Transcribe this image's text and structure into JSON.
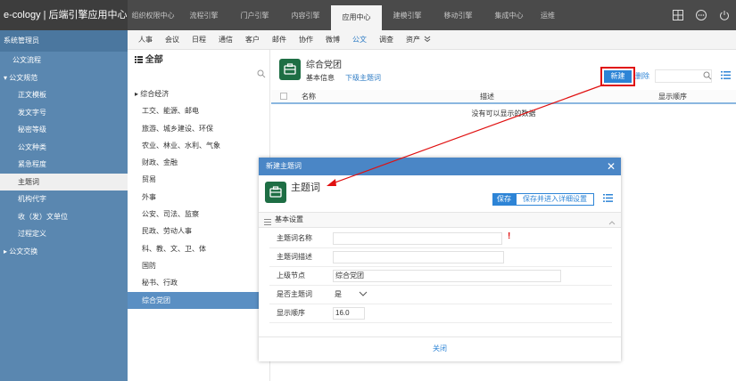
{
  "brand": "e-cology | 后端引擎应用中心",
  "top_nav": [
    "组织权限中心",
    "流程引擎",
    "门户引擎",
    "内容引擎",
    "应用中心",
    "建模引擎",
    "移动引擎",
    "集成中心",
    "运维"
  ],
  "sidebar": {
    "title": "系统管理员",
    "items": [
      "公文流程",
      "公文规范",
      "正文模板",
      "发文字号",
      "秘密等级",
      "公文种类",
      "紧急程度",
      "主题词",
      "机构代字",
      "收（发）文单位",
      "过程定义",
      "公文交换"
    ]
  },
  "subnav": [
    "人事",
    "会议",
    "日程",
    "通信",
    "客户",
    "邮件",
    "协作",
    "微博",
    "公文",
    "调查",
    "资产"
  ],
  "tree": {
    "head": "全部",
    "items": [
      "综合经济",
      "工交、能源、邮电",
      "旅游、城乡建设、环保",
      "农业、林业、水利、气象",
      "财政、金融",
      "贸易",
      "外事",
      "公安、司法、监察",
      "民政、劳动人事",
      "科、教、文、卫、体",
      "国防",
      "秘书、行政",
      "综合党团"
    ]
  },
  "main": {
    "title": "综合党团",
    "tab_basic": "基本信息",
    "tab_sub": "下级主题词",
    "new_label": "新建",
    "del_label": "删除",
    "columns": [
      "名称",
      "描述",
      "显示顺序"
    ],
    "empty": "没有可以显示的数据"
  },
  "modal": {
    "header": "新建主题词",
    "title": "主题词",
    "save": "保存",
    "save_next": "保存并进入详细设置",
    "section": "基本设置",
    "fields": {
      "name_label": "主题词名称",
      "desc_label": "主题词描述",
      "parent_label": "上级节点",
      "parent_value": "综合党团",
      "is_label": "是否主题词",
      "is_value": "是",
      "order_label": "显示顺序",
      "order_value": "16.0"
    },
    "close": "关闭"
  },
  "colors": {
    "accent": "#2d84d6",
    "sidebar": "#5a87b0",
    "highlight": "#e01010",
    "logo": "#1e6e44"
  }
}
